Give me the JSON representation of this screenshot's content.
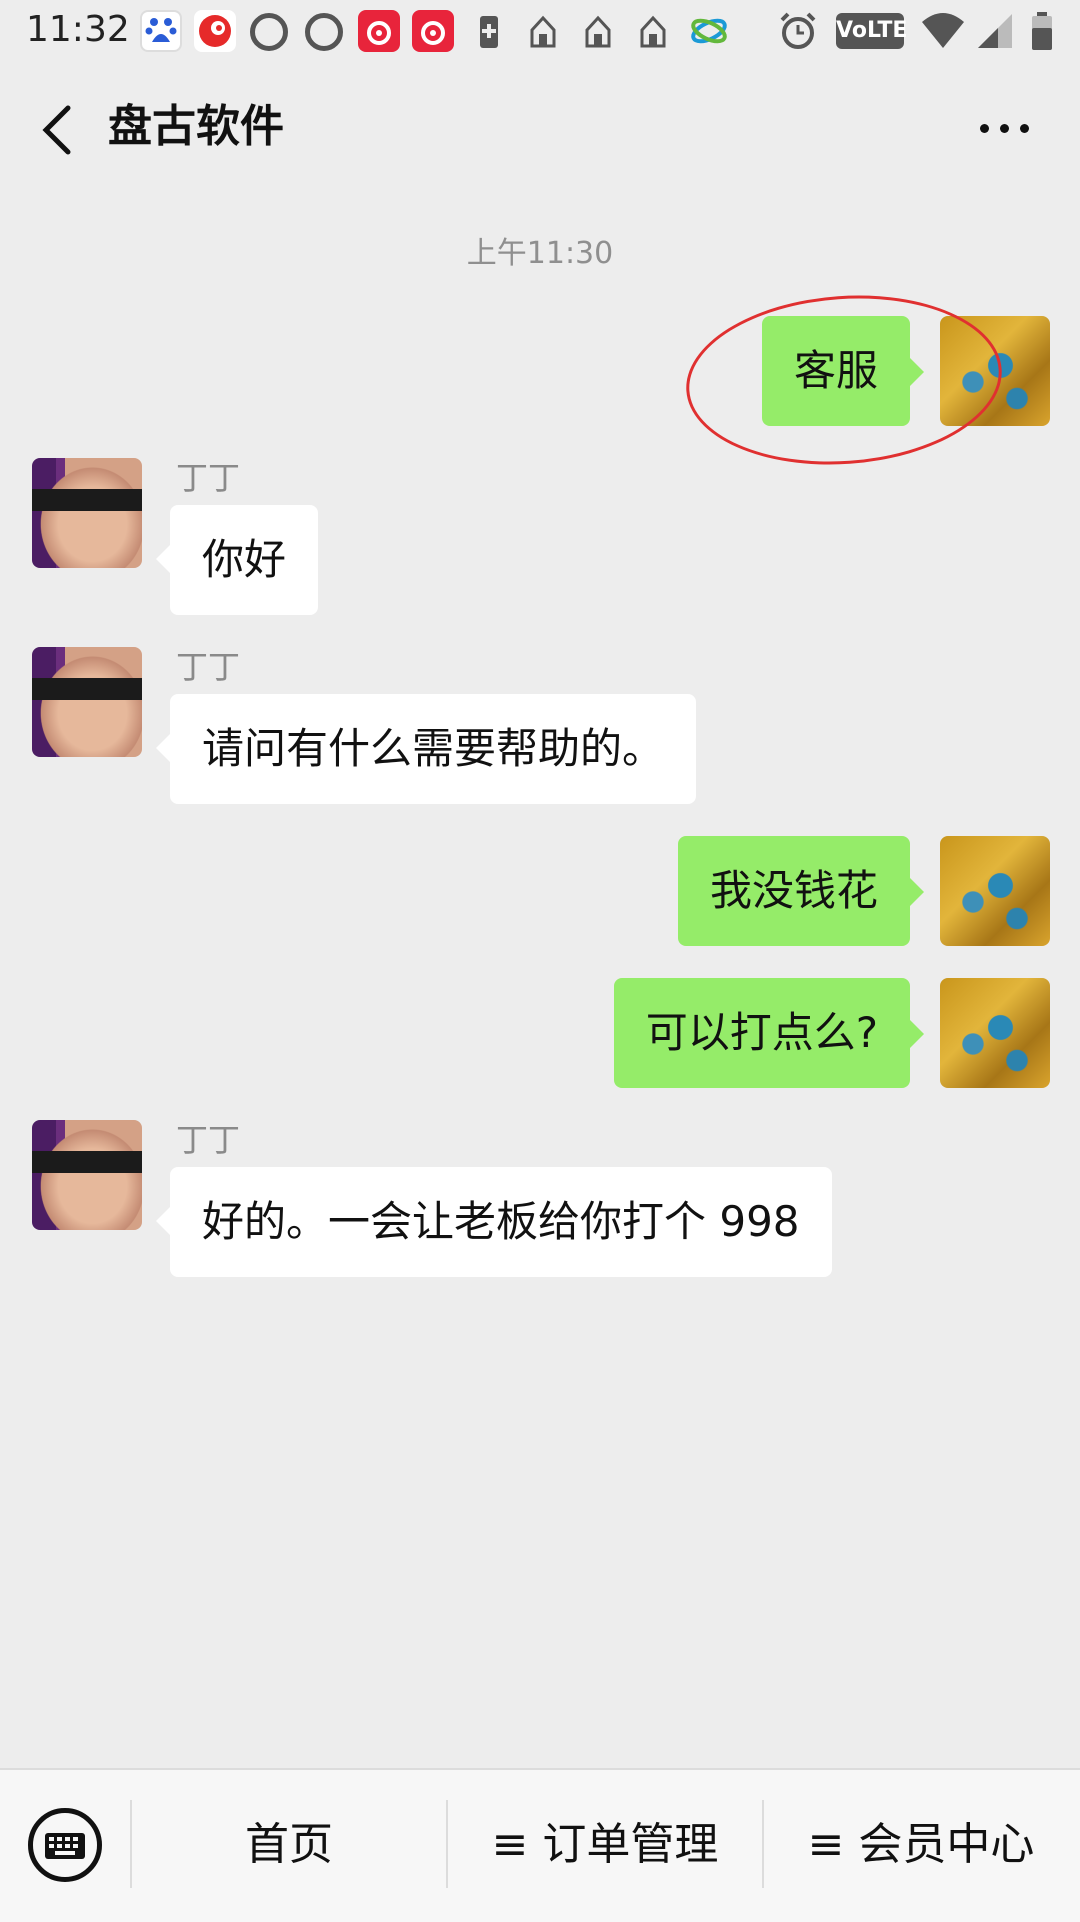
{
  "status_bar": {
    "time": "11:32",
    "network": "VoLTE",
    "icons": [
      "baidu-app-icon",
      "app-icon",
      "notification-icon",
      "notification-icon",
      "weibo-icon",
      "weibo-icon",
      "battery-plus-icon",
      "home-icon",
      "home-icon",
      "home-icon",
      "china-mobile-icon",
      "alarm-icon",
      "wifi-icon",
      "signal-icon",
      "battery-icon"
    ]
  },
  "header": {
    "title": "盘古软件"
  },
  "chat": {
    "timestamp": "上午11:30",
    "messages": [
      {
        "direction": "out",
        "text": "客服"
      },
      {
        "direction": "in",
        "sender": "丁丁",
        "text": "你好"
      },
      {
        "direction": "in",
        "sender": "丁丁",
        "text": "请问有什么需要帮助的。"
      },
      {
        "direction": "out",
        "text": "我没钱花"
      },
      {
        "direction": "out",
        "text": "可以打点么?"
      },
      {
        "direction": "in",
        "sender": "丁丁",
        "text": "好的。一会让老板给你打个 998"
      }
    ]
  },
  "bottom_bar": {
    "tabs": [
      {
        "label": "首页"
      },
      {
        "label": "≡ 订单管理"
      },
      {
        "label": "≡ 会员中心"
      }
    ]
  },
  "colors": {
    "background": "#ededed",
    "bubble_out": "#95ec69",
    "bubble_in": "#ffffff",
    "annotation": "#e03030"
  }
}
